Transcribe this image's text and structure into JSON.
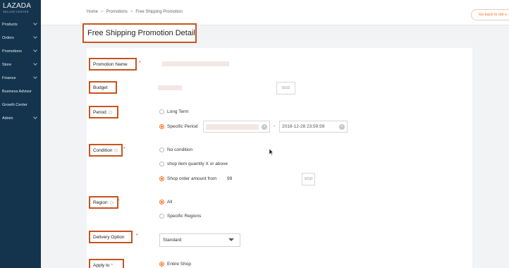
{
  "sidebar": {
    "logo": "LAZADA",
    "logo_sub": "SELLER CENTER",
    "items": [
      {
        "label": "Products",
        "has_children": true
      },
      {
        "label": "Orders",
        "has_children": true
      },
      {
        "label": "Promotions",
        "has_children": true
      },
      {
        "label": "Store",
        "has_children": true
      },
      {
        "label": "Finance",
        "has_children": true
      },
      {
        "label": "Business Advisor",
        "has_children": false
      },
      {
        "label": "Growth Center",
        "has_children": false
      },
      {
        "label": "Admin",
        "has_children": true
      }
    ]
  },
  "breadcrumb": [
    "Home",
    "Promotions",
    "Free Shipping Promotion"
  ],
  "back_button": "Go back to old v...",
  "page_title": "Free Shipping Promotion Detail",
  "form": {
    "promotion_name_label": "Promotion Name",
    "budget_label": "Budget",
    "budget_unit": "SGD",
    "period_label": "Period",
    "period_options": [
      "Long Term",
      "Specific Period"
    ],
    "period_selected": "Specific Period",
    "period_end_value": "2018-12-28 23:59:59",
    "condition_label": "Condition",
    "condition_options": [
      "No condition",
      "shop item quantity X or above",
      "Shop order amount from"
    ],
    "condition_selected": "Shop order amount from",
    "order_amount_value": "99",
    "order_amount_unit": "SGD",
    "region_label": "Region",
    "region_options": [
      "All",
      "Specific Regions"
    ],
    "region_selected": "All",
    "delivery_label": "Delivery Option",
    "delivery_value": "Standard",
    "apply_to_label": "Apply to",
    "apply_to_option": "Entire Shop"
  },
  "colors": {
    "sidebar_bg": "#14344e",
    "highlight_border": "#c8541f",
    "accent": "#f57224"
  }
}
